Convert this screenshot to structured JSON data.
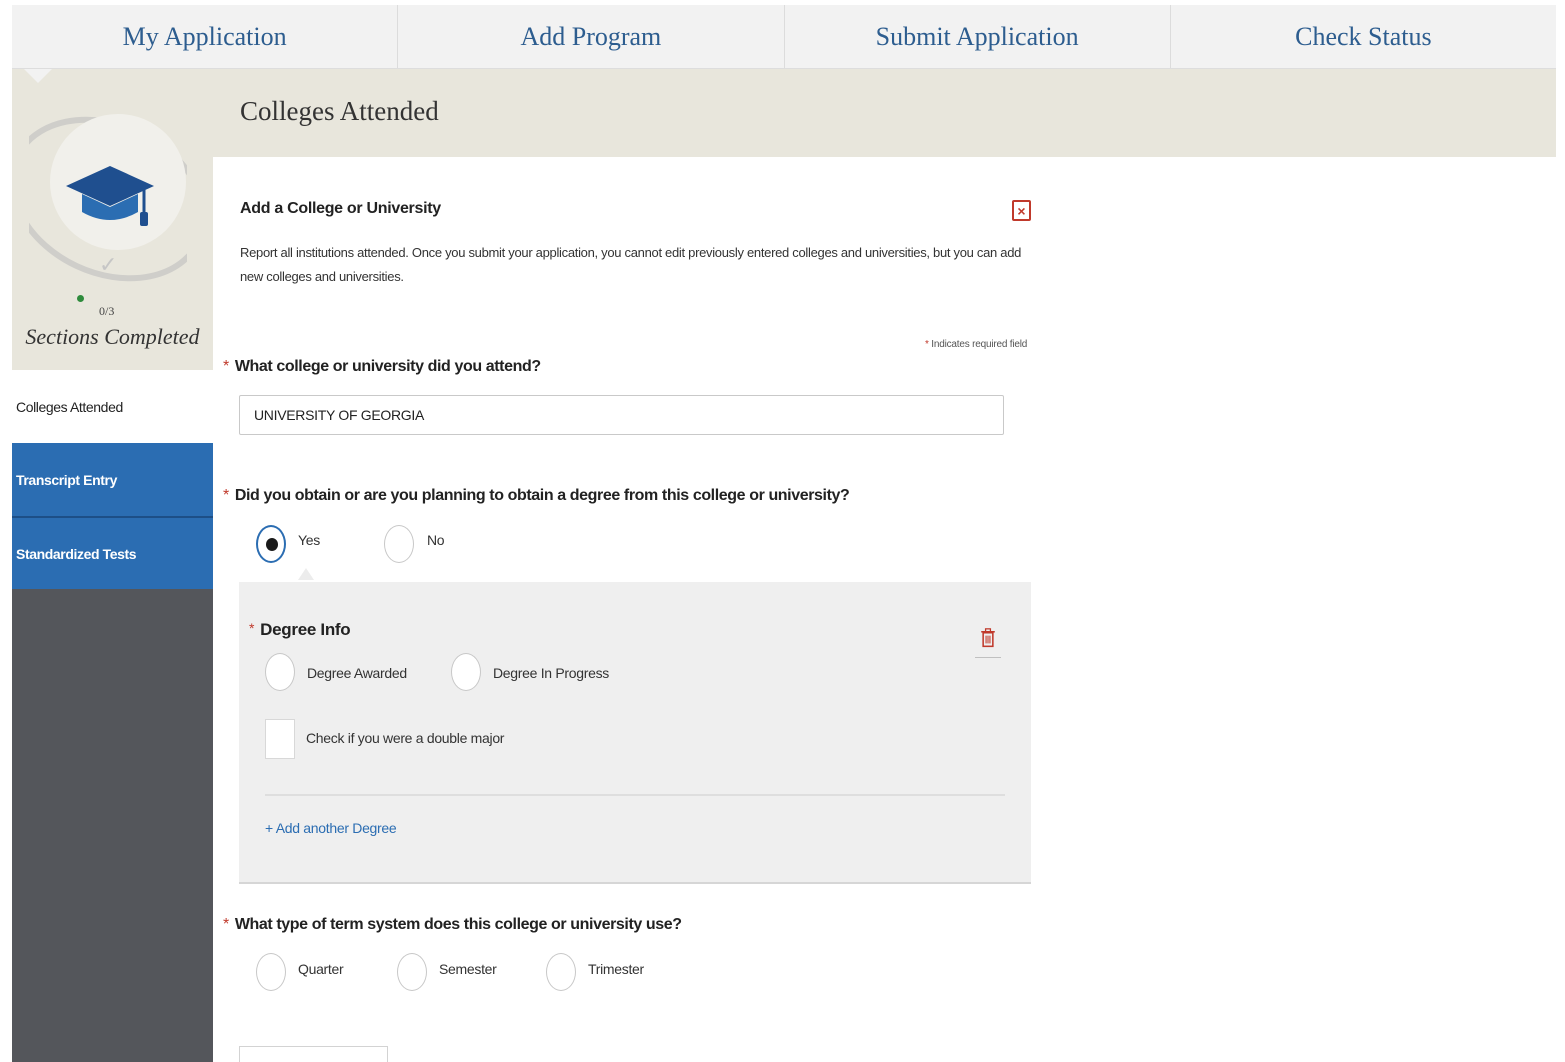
{
  "topnav": {
    "tabs": [
      {
        "label": "My Application"
      },
      {
        "label": "Add Program"
      },
      {
        "label": "Submit Application"
      },
      {
        "label": "Check Status"
      }
    ]
  },
  "progress": {
    "count": "0/3",
    "label": "Sections Completed",
    "completed": 0,
    "total": 3
  },
  "sidebar": {
    "items": [
      {
        "label": "Colleges Attended"
      },
      {
        "label": "Transcript Entry"
      },
      {
        "label": "Standardized Tests"
      }
    ]
  },
  "header": {
    "title": "Colleges Attended"
  },
  "form": {
    "heading": "Add a College or University",
    "close_icon": "×",
    "description": "Report all institutions attended. Once you submit your application, you cannot edit previously entered colleges and universities, but you can add new colleges and universities.",
    "required_star": "*",
    "required_note": "Indicates required field",
    "q1": {
      "label": "What college or university did you attend?",
      "value": "UNIVERSITY OF GEORGIA"
    },
    "q2": {
      "label": "Did you obtain or are you planning to obtain a degree from this college or university?",
      "yes": "Yes",
      "no": "No",
      "selected": "Yes"
    },
    "degree": {
      "title": "Degree Info",
      "awarded": "Degree Awarded",
      "in_progress": "Degree In Progress",
      "double_major": "Check if you were a double major",
      "add_link": "+ Add another Degree"
    },
    "q3": {
      "label": "What type of term system does this college or university use?",
      "options": [
        "Quarter",
        "Semester",
        "Trimester"
      ]
    }
  },
  "colors": {
    "accent_blue": "#2b6db2",
    "required_red": "#c0392b",
    "sidebar_dark": "#54565b",
    "band_beige": "#e8e6dc"
  }
}
